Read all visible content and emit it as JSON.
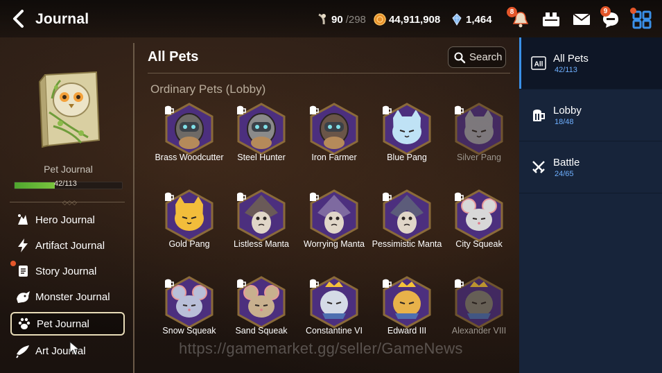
{
  "header": {
    "title": "Journal",
    "stamina": {
      "current": "90",
      "max": "/298"
    },
    "gold": "44,911,908",
    "crystals": "1,464",
    "notifications_badge": "8",
    "chat_badge": "9"
  },
  "left": {
    "book_label": "Pet Journal",
    "progress_text": "42/113",
    "progress_fraction": 0.372,
    "nav": [
      {
        "label": "Hero Journal",
        "icon": "hero-icon"
      },
      {
        "label": "Artifact Journal",
        "icon": "lightning-icon"
      },
      {
        "label": "Story Journal",
        "icon": "scroll-icon"
      },
      {
        "label": "Monster Journal",
        "icon": "monster-icon"
      },
      {
        "label": "Pet Journal",
        "icon": "paw-icon"
      },
      {
        "label": "Art Journal",
        "icon": "brush-icon"
      }
    ]
  },
  "main": {
    "title": "All Pets",
    "search_label": "Search",
    "category": "Ordinary Pets (Lobby)",
    "pets": [
      {
        "name": "Brass Woodcutter",
        "kind": "knight",
        "color": "#6e6a66",
        "owned": true
      },
      {
        "name": "Steel Hunter",
        "kind": "knight",
        "color": "#8a8a8a",
        "owned": true
      },
      {
        "name": "Iron Farmer",
        "kind": "knight",
        "color": "#6a5548",
        "owned": true
      },
      {
        "name": "Blue Pang",
        "kind": "cat",
        "color": "#bfe2f5",
        "owned": true
      },
      {
        "name": "Silver Pang",
        "kind": "cat",
        "color": "#9a9aa4",
        "owned": false
      },
      {
        "name": "Gold Pang",
        "kind": "cat",
        "color": "#f2bd3b",
        "owned": true
      },
      {
        "name": "Listless Manta",
        "kind": "manta",
        "color": "#6a5a58",
        "owned": true
      },
      {
        "name": "Worrying Manta",
        "kind": "manta",
        "color": "#7e6aa0",
        "owned": true
      },
      {
        "name": "Pessimistic Manta",
        "kind": "manta",
        "color": "#5c5c7a",
        "owned": true
      },
      {
        "name": "City Squeak",
        "kind": "mouse",
        "color": "#d8d8d8",
        "owned": true
      },
      {
        "name": "Snow Squeak",
        "kind": "mouse",
        "color": "#b9bfd8",
        "owned": true
      },
      {
        "name": "Sand Squeak",
        "kind": "mouse",
        "color": "#c8b08e",
        "owned": true
      },
      {
        "name": "Constantine VI",
        "kind": "royal",
        "color": "#d5dbe6",
        "owned": true
      },
      {
        "name": "Edward III",
        "kind": "royal",
        "color": "#e8b24a",
        "owned": true
      },
      {
        "name": "Alexander VIII",
        "kind": "royal",
        "color": "#7f7a70",
        "owned": false
      }
    ]
  },
  "right": {
    "tabs": [
      {
        "label": "All Pets",
        "count": "42/113",
        "icon": "all-icon"
      },
      {
        "label": "Lobby",
        "count": "18/48",
        "icon": "mug-icon"
      },
      {
        "label": "Battle",
        "count": "24/65",
        "icon": "swords-icon"
      }
    ],
    "all_icon_text": "All"
  },
  "watermark": "https://gamemarket.gg/seller/GameNews",
  "colors": {
    "accent": "#3a90e8",
    "progress": "#5fb236",
    "badge": "#e4562a",
    "hex_purple": "#4c2f7e"
  }
}
